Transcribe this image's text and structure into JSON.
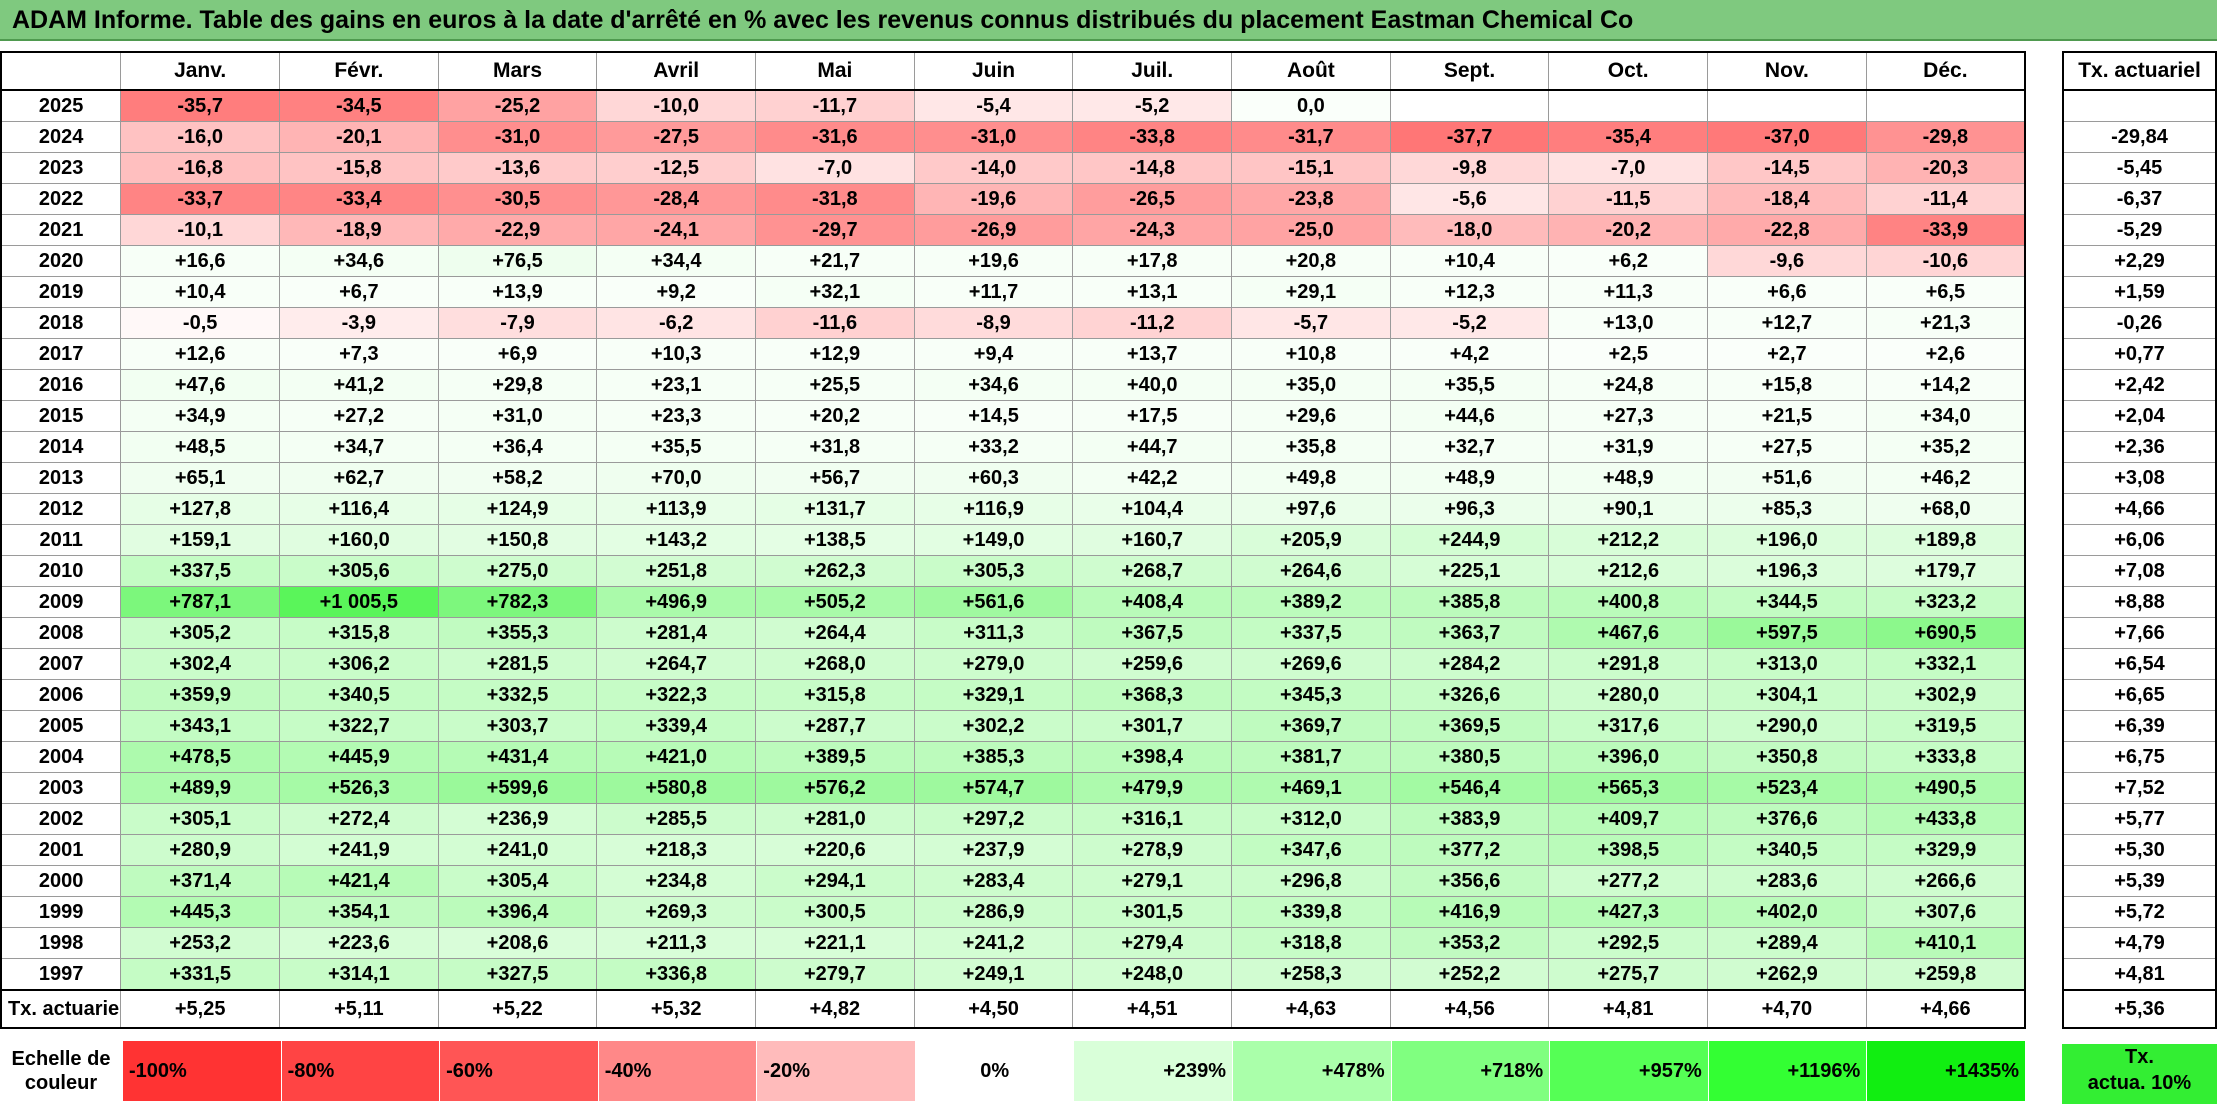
{
  "title": "ADAM Informe. Table des gains en euros à la date d'arrêté en % avec les revenus connus distribués du placement Eastman Chemical Co",
  "months": [
    "Janv.",
    "Févr.",
    "Mars",
    "Avril",
    "Mai",
    "Juin",
    "Juil.",
    "Août",
    "Sept.",
    "Oct.",
    "Nov.",
    "Déc."
  ],
  "side_header": "Tx. actuariel",
  "rows": [
    {
      "year": "2025",
      "values": [
        "-35,7",
        "-34,5",
        "-25,2",
        "-10,0",
        "-11,7",
        "-5,4",
        "-5,2",
        "0,0",
        "",
        "",
        "",
        ""
      ],
      "rate": ""
    },
    {
      "year": "2024",
      "values": [
        "-16,0",
        "-20,1",
        "-31,0",
        "-27,5",
        "-31,6",
        "-31,0",
        "-33,8",
        "-31,7",
        "-37,7",
        "-35,4",
        "-37,0",
        "-29,8"
      ],
      "rate": "-29,84"
    },
    {
      "year": "2023",
      "values": [
        "-16,8",
        "-15,8",
        "-13,6",
        "-12,5",
        "-7,0",
        "-14,0",
        "-14,8",
        "-15,1",
        "-9,8",
        "-7,0",
        "-14,5",
        "-20,3"
      ],
      "rate": "-5,45"
    },
    {
      "year": "2022",
      "values": [
        "-33,7",
        "-33,4",
        "-30,5",
        "-28,4",
        "-31,8",
        "-19,6",
        "-26,5",
        "-23,8",
        "-5,6",
        "-11,5",
        "-18,4",
        "-11,4"
      ],
      "rate": "-6,37"
    },
    {
      "year": "2021",
      "values": [
        "-10,1",
        "-18,9",
        "-22,9",
        "-24,1",
        "-29,7",
        "-26,9",
        "-24,3",
        "-25,0",
        "-18,0",
        "-20,2",
        "-22,8",
        "-33,9"
      ],
      "rate": "-5,29"
    },
    {
      "year": "2020",
      "values": [
        "+16,6",
        "+34,6",
        "+76,5",
        "+34,4",
        "+21,7",
        "+19,6",
        "+17,8",
        "+20,8",
        "+10,4",
        "+6,2",
        "-9,6",
        "-10,6"
      ],
      "rate": "+2,29"
    },
    {
      "year": "2019",
      "values": [
        "+10,4",
        "+6,7",
        "+13,9",
        "+9,2",
        "+32,1",
        "+11,7",
        "+13,1",
        "+29,1",
        "+12,3",
        "+11,3",
        "+6,6",
        "+6,5"
      ],
      "rate": "+1,59"
    },
    {
      "year": "2018",
      "values": [
        "-0,5",
        "-3,9",
        "-7,9",
        "-6,2",
        "-11,6",
        "-8,9",
        "-11,2",
        "-5,7",
        "-5,2",
        "+13,0",
        "+12,7",
        "+21,3"
      ],
      "rate": "-0,26"
    },
    {
      "year": "2017",
      "values": [
        "+12,6",
        "+7,3",
        "+6,9",
        "+10,3",
        "+12,9",
        "+9,4",
        "+13,7",
        "+10,8",
        "+4,2",
        "+2,5",
        "+2,7",
        "+2,6"
      ],
      "rate": "+0,77"
    },
    {
      "year": "2016",
      "values": [
        "+47,6",
        "+41,2",
        "+29,8",
        "+23,1",
        "+25,5",
        "+34,6",
        "+40,0",
        "+35,0",
        "+35,5",
        "+24,8",
        "+15,8",
        "+14,2"
      ],
      "rate": "+2,42"
    },
    {
      "year": "2015",
      "values": [
        "+34,9",
        "+27,2",
        "+31,0",
        "+23,3",
        "+20,2",
        "+14,5",
        "+17,5",
        "+29,6",
        "+44,6",
        "+27,3",
        "+21,5",
        "+34,0"
      ],
      "rate": "+2,04"
    },
    {
      "year": "2014",
      "values": [
        "+48,5",
        "+34,7",
        "+36,4",
        "+35,5",
        "+31,8",
        "+33,2",
        "+44,7",
        "+35,8",
        "+32,7",
        "+31,9",
        "+27,5",
        "+35,2"
      ],
      "rate": "+2,36"
    },
    {
      "year": "2013",
      "values": [
        "+65,1",
        "+62,7",
        "+58,2",
        "+70,0",
        "+56,7",
        "+60,3",
        "+42,2",
        "+49,8",
        "+48,9",
        "+48,9",
        "+51,6",
        "+46,2"
      ],
      "rate": "+3,08"
    },
    {
      "year": "2012",
      "values": [
        "+127,8",
        "+116,4",
        "+124,9",
        "+113,9",
        "+131,7",
        "+116,9",
        "+104,4",
        "+97,6",
        "+96,3",
        "+90,1",
        "+85,3",
        "+68,0"
      ],
      "rate": "+4,66"
    },
    {
      "year": "2011",
      "values": [
        "+159,1",
        "+160,0",
        "+150,8",
        "+143,2",
        "+138,5",
        "+149,0",
        "+160,7",
        "+205,9",
        "+244,9",
        "+212,2",
        "+196,0",
        "+189,8"
      ],
      "rate": "+6,06"
    },
    {
      "year": "2010",
      "values": [
        "+337,5",
        "+305,6",
        "+275,0",
        "+251,8",
        "+262,3",
        "+305,3",
        "+268,7",
        "+264,6",
        "+225,1",
        "+212,6",
        "+196,3",
        "+179,7"
      ],
      "rate": "+7,08"
    },
    {
      "year": "2009",
      "values": [
        "+787,1",
        "+1 005,5",
        "+782,3",
        "+496,9",
        "+505,2",
        "+561,6",
        "+408,4",
        "+389,2",
        "+385,8",
        "+400,8",
        "+344,5",
        "+323,2"
      ],
      "rate": "+8,88"
    },
    {
      "year": "2008",
      "values": [
        "+305,2",
        "+315,8",
        "+355,3",
        "+281,4",
        "+264,4",
        "+311,3",
        "+367,5",
        "+337,5",
        "+363,7",
        "+467,6",
        "+597,5",
        "+690,5"
      ],
      "rate": "+7,66"
    },
    {
      "year": "2007",
      "values": [
        "+302,4",
        "+306,2",
        "+281,5",
        "+264,7",
        "+268,0",
        "+279,0",
        "+259,6",
        "+269,6",
        "+284,2",
        "+291,8",
        "+313,0",
        "+332,1"
      ],
      "rate": "+6,54"
    },
    {
      "year": "2006",
      "values": [
        "+359,9",
        "+340,5",
        "+332,5",
        "+322,3",
        "+315,8",
        "+329,1",
        "+368,3",
        "+345,3",
        "+326,6",
        "+280,0",
        "+304,1",
        "+302,9"
      ],
      "rate": "+6,65"
    },
    {
      "year": "2005",
      "values": [
        "+343,1",
        "+322,7",
        "+303,7",
        "+339,4",
        "+287,7",
        "+302,2",
        "+301,7",
        "+369,7",
        "+369,5",
        "+317,6",
        "+290,0",
        "+319,5"
      ],
      "rate": "+6,39"
    },
    {
      "year": "2004",
      "values": [
        "+478,5",
        "+445,9",
        "+431,4",
        "+421,0",
        "+389,5",
        "+385,3",
        "+398,4",
        "+381,7",
        "+380,5",
        "+396,0",
        "+350,8",
        "+333,8"
      ],
      "rate": "+6,75"
    },
    {
      "year": "2003",
      "values": [
        "+489,9",
        "+526,3",
        "+599,6",
        "+580,8",
        "+576,2",
        "+574,7",
        "+479,9",
        "+469,1",
        "+546,4",
        "+565,3",
        "+523,4",
        "+490,5"
      ],
      "rate": "+7,52"
    },
    {
      "year": "2002",
      "values": [
        "+305,1",
        "+272,4",
        "+236,9",
        "+285,5",
        "+281,0",
        "+297,2",
        "+316,1",
        "+312,0",
        "+383,9",
        "+409,7",
        "+376,6",
        "+433,8"
      ],
      "rate": "+5,77"
    },
    {
      "year": "2001",
      "values": [
        "+280,9",
        "+241,9",
        "+241,0",
        "+218,3",
        "+220,6",
        "+237,9",
        "+278,9",
        "+347,6",
        "+377,2",
        "+398,5",
        "+340,5",
        "+329,9"
      ],
      "rate": "+5,30"
    },
    {
      "year": "2000",
      "values": [
        "+371,4",
        "+421,4",
        "+305,4",
        "+234,8",
        "+294,1",
        "+283,4",
        "+279,1",
        "+296,8",
        "+356,6",
        "+277,2",
        "+283,6",
        "+266,6"
      ],
      "rate": "+5,39"
    },
    {
      "year": "1999",
      "values": [
        "+445,3",
        "+354,1",
        "+396,4",
        "+269,3",
        "+300,5",
        "+286,9",
        "+301,5",
        "+339,8",
        "+416,9",
        "+427,3",
        "+402,0",
        "+307,6"
      ],
      "rate": "+5,72"
    },
    {
      "year": "1998",
      "values": [
        "+253,2",
        "+223,6",
        "+208,6",
        "+211,3",
        "+221,1",
        "+241,2",
        "+279,4",
        "+318,8",
        "+353,2",
        "+292,5",
        "+289,4",
        "+410,1"
      ],
      "rate": "+4,79"
    },
    {
      "year": "1997",
      "values": [
        "+331,5",
        "+314,1",
        "+327,5",
        "+336,8",
        "+279,7",
        "+249,1",
        "+248,0",
        "+258,3",
        "+252,2",
        "+275,7",
        "+262,9",
        "+259,8"
      ],
      "rate": "+4,81"
    }
  ],
  "footer": {
    "label": "Tx. actuariel",
    "values": [
      "+5,25",
      "+5,11",
      "+5,22",
      "+5,32",
      "+4,82",
      "+4,50",
      "+4,51",
      "+4,63",
      "+4,56",
      "+4,81",
      "+4,70",
      "+4,66"
    ],
    "rate": "+5,36"
  },
  "scale": {
    "label_line1": "Echelle de",
    "label_line2": "couleur",
    "steps": [
      {
        "label": "-100%",
        "color": "#ff3333"
      },
      {
        "label": "-80%",
        "color": "#ff4444"
      },
      {
        "label": "-60%",
        "color": "#ff5555"
      },
      {
        "label": "-40%",
        "color": "#ff8888"
      },
      {
        "label": "-20%",
        "color": "#ffbbbb"
      },
      {
        "label": "0%",
        "color": "#ffffff"
      },
      {
        "label": "+239%",
        "color": "#d9ffd9"
      },
      {
        "label": "+478%",
        "color": "#aaffaa"
      },
      {
        "label": "+718%",
        "color": "#80ff80"
      },
      {
        "label": "+957%",
        "color": "#55ff55"
      },
      {
        "label": "+1196%",
        "color": "#33ff33"
      },
      {
        "label": "+1435%",
        "color": "#11ee11"
      }
    ],
    "side_line1": "Tx.",
    "side_line2": "actua. 10%",
    "side_color": "#33ee33"
  }
}
